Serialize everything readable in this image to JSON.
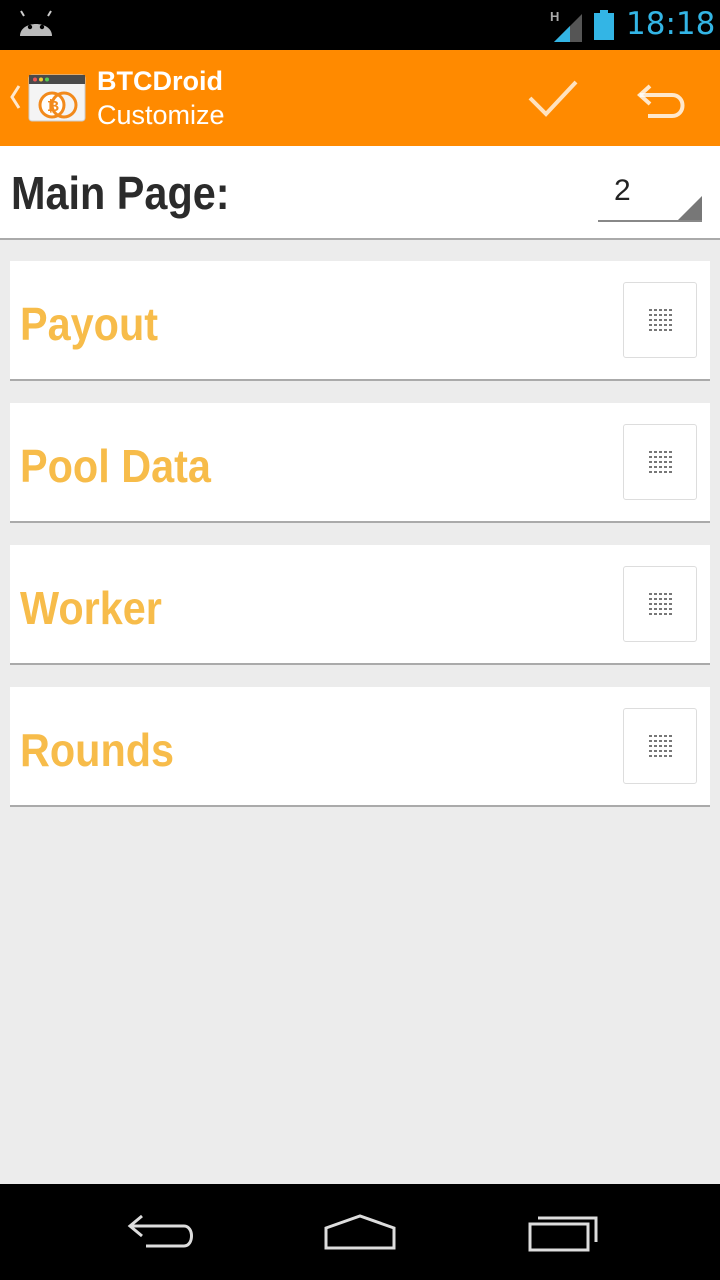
{
  "status_bar": {
    "time": "18:18",
    "network": "H"
  },
  "action_bar": {
    "title": "BTCDroid",
    "subtitle": "Customize",
    "background": "#ff8a00"
  },
  "main_page": {
    "label": "Main Page:",
    "selected_value": "2"
  },
  "sections": [
    {
      "label": "Payout"
    },
    {
      "label": "Pool Data"
    },
    {
      "label": "Worker"
    },
    {
      "label": "Rounds"
    }
  ],
  "colors": {
    "accent": "#ff8a00",
    "section_label": "#f7bc4a",
    "clock": "#33b5e5"
  },
  "icons": {
    "status": [
      "android-icon",
      "signal-icon",
      "battery-icon"
    ],
    "action_bar": [
      "up-chevron-icon",
      "app-icon",
      "checkmark-icon",
      "undo-icon"
    ],
    "nav": [
      "back-icon",
      "home-icon",
      "recent-apps-icon"
    ],
    "section": "drag-handle-icon"
  }
}
